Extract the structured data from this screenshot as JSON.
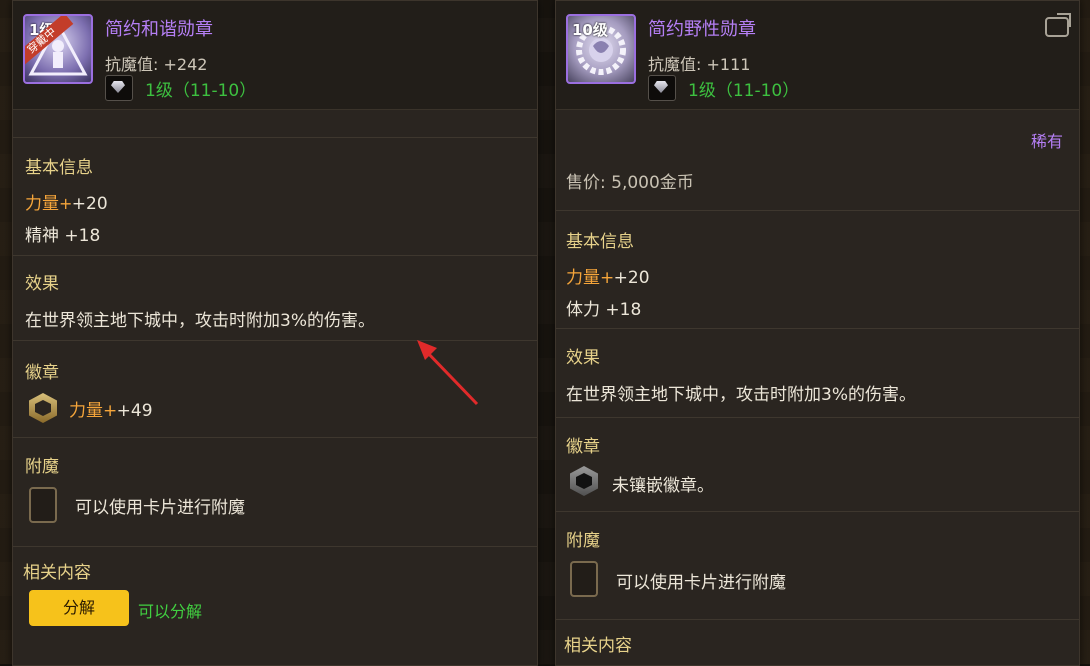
{
  "left_card": {
    "level_tag": "1级",
    "ribbon": "穿戴中",
    "title": "简约和谐勋章",
    "attr": "抗魔值: +242",
    "tier": "1级（11-10）",
    "basic_title": "基本信息",
    "stat1_name": "力量",
    "stat1_value": " +20",
    "stat2": "精神 +18",
    "effect_title": "效果",
    "effect_text": "在世界领主地下城中，攻击时附加3%的伤害。",
    "badge_title": "徽章",
    "badge_stat_name": "力量",
    "badge_stat_value": " +49",
    "enchant_title": "附魔",
    "enchant_text": "可以使用卡片进行附魔",
    "related_title": "相关内容",
    "btn_disassemble": "分解",
    "can_disassemble": "可以分解"
  },
  "right_card": {
    "level_tag": "10级",
    "title": "简约野性勋章",
    "attr": "抗魔值: +111",
    "tier": "1级（11-10）",
    "rarity": "稀有",
    "price": "售价: 5,000金币",
    "basic_title": "基本信息",
    "stat1_name": "力量",
    "stat1_value": " +20",
    "stat2": "体力 +18",
    "effect_title": "效果",
    "effect_text": "在世界领主地下城中，攻击时附加3%的伤害。",
    "badge_title": "徽章",
    "badge_text": "未镶嵌徽章。",
    "enchant_title": "附魔",
    "enchant_text": "可以使用卡片进行附魔",
    "related_title": "相关内容"
  },
  "colors": {
    "accent_purple": "#b57ff5",
    "stat_orange": "#f5a53a",
    "green": "#41d041",
    "button_yellow": "#f6c21b"
  }
}
